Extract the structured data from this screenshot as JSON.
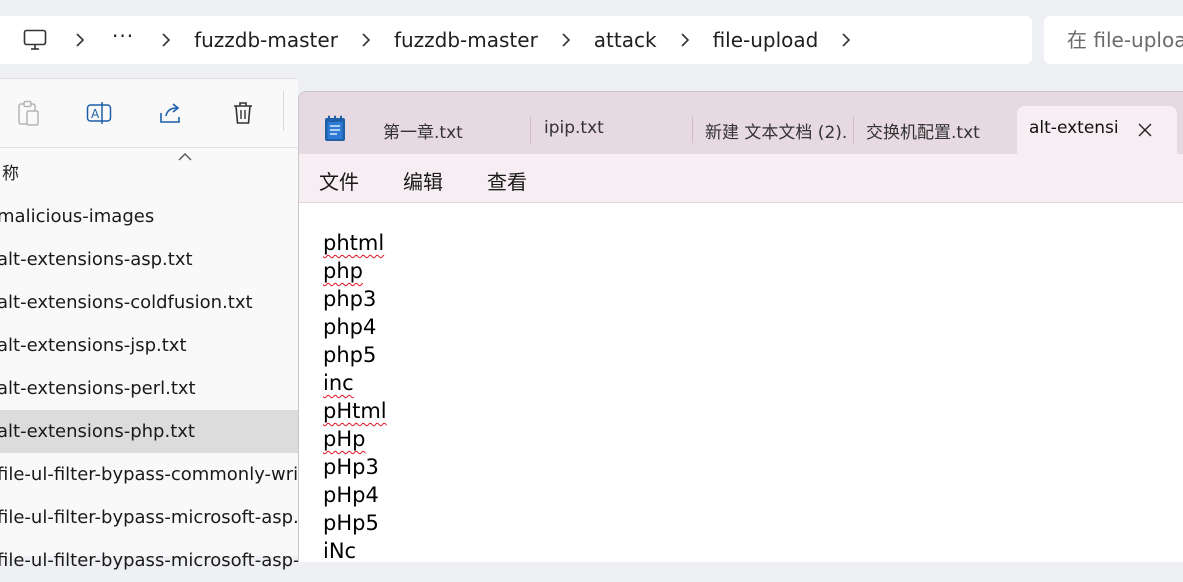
{
  "breadcrumb": {
    "overflow": "···",
    "segments": [
      "fuzzdb-master",
      "fuzzdb-master",
      "attack",
      "file-upload"
    ]
  },
  "search": {
    "placeholder": "在 file-upload 中搜索"
  },
  "explorer": {
    "column_name": "称",
    "files": [
      {
        "name": "malicious-images",
        "selected": false
      },
      {
        "name": "alt-extensions-asp.txt",
        "selected": false
      },
      {
        "name": "alt-extensions-coldfusion.txt",
        "selected": false
      },
      {
        "name": "alt-extensions-jsp.txt",
        "selected": false
      },
      {
        "name": "alt-extensions-perl.txt",
        "selected": false
      },
      {
        "name": "alt-extensions-php.txt",
        "selected": true
      },
      {
        "name": "file-ul-filter-bypass-commonly-writable-directories.txt",
        "selected": false
      },
      {
        "name": "file-ul-filter-bypass-microsoft-asp.txt",
        "selected": false
      },
      {
        "name": "file-ul-filter-bypass-microsoft-asp-filetype-bf.txt",
        "selected": false
      }
    ]
  },
  "notepad": {
    "tabs": [
      "第一章.txt",
      "ipip.txt",
      "新建 文本文档 (2).txt",
      "交换机配置.txt"
    ],
    "active_tab": "alt-extensions-php.txt",
    "menu": [
      "文件",
      "编辑",
      "查看"
    ],
    "lines": [
      {
        "text": "phtml",
        "spell": true
      },
      {
        "text": "php",
        "spell": true
      },
      {
        "text": "php3",
        "spell": false
      },
      {
        "text": "php4",
        "spell": false
      },
      {
        "text": "php5",
        "spell": false
      },
      {
        "text": "inc",
        "spell": true
      },
      {
        "text": "pHtml",
        "spell": true
      },
      {
        "text": "pHp",
        "spell": true
      },
      {
        "text": "pHp3",
        "spell": false
      },
      {
        "text": "pHp4",
        "spell": false
      },
      {
        "text": "pHp5",
        "spell": false
      },
      {
        "text": "iNc",
        "spell": true
      }
    ]
  },
  "colors": {
    "tabbar": "#e7d9e1",
    "menubar": "#f6eef3",
    "selection": "#dcdcdc",
    "spellcheck": "#e81123"
  }
}
